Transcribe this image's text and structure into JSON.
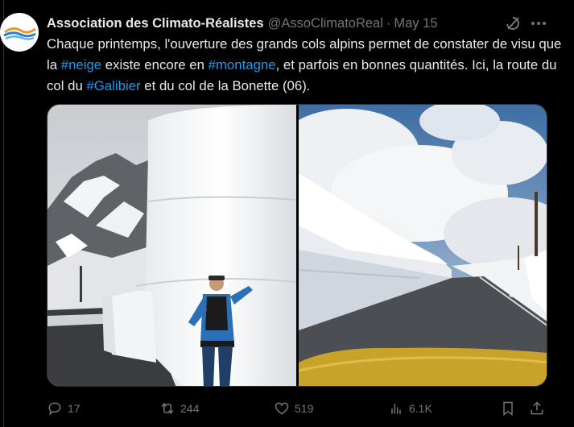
{
  "tweet": {
    "author": {
      "display_name": "Association des Climato-Réalistes",
      "handle": "@AssoClimatoReal",
      "separator": "·",
      "date": "May 15"
    },
    "text": {
      "part1": "Chaque printemps, l'ouverture des grands cols alpins permet de constater de visu que la ",
      "tag1": "#neige",
      "part2": " existe encore en ",
      "tag2": "#montagne",
      "part3": ", et parfois en bonnes quantités. Ici, la route du col du ",
      "tag3": "#Galibier",
      "part4": " et du col de la Bonette (06)."
    },
    "icons": {
      "grok": "grok-icon",
      "more": "more-icon"
    },
    "media": [
      {
        "name": "galibier-snow-wall-photo"
      },
      {
        "name": "bonette-road-snow-photo"
      }
    ],
    "actions": {
      "replies": "17",
      "reposts": "244",
      "likes": "519",
      "views": "6.1K"
    }
  },
  "colors": {
    "background": "#000000",
    "text": "#e7e9ea",
    "muted": "#71767b",
    "link": "#1d9bf0",
    "border": "#2f3336"
  }
}
